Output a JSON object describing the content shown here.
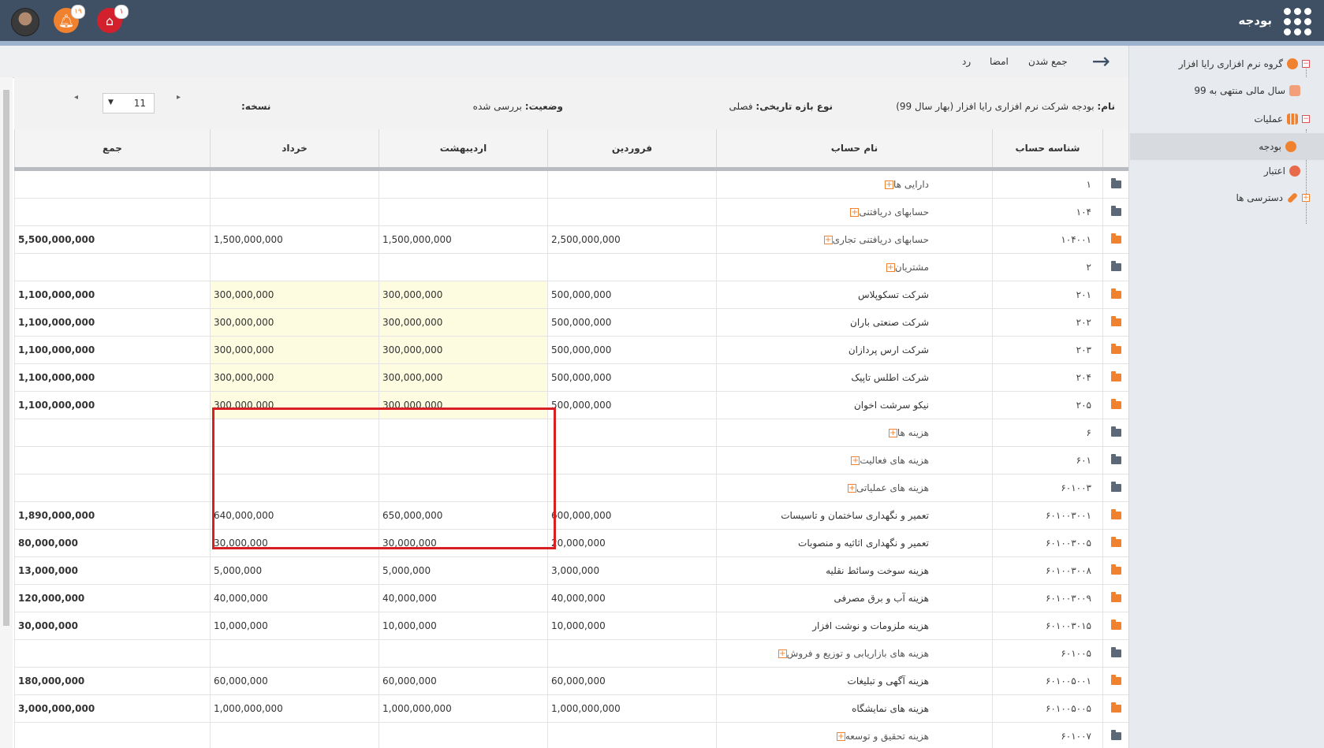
{
  "header": {
    "app_title": "بودجه",
    "notifications": [
      {
        "icon": "bell-icon",
        "count": "۱۹",
        "color": "#f0812e"
      },
      {
        "icon": "alert-icon",
        "count": "۱",
        "color": "#d3202d"
      }
    ]
  },
  "sidebar": {
    "items": [
      {
        "label": "گروه نرم افزاری رایا افزار",
        "icon": "org-icon",
        "toggle": "−"
      },
      {
        "label": "سال مالی منتهی به 99",
        "icon": "calendar-icon"
      },
      {
        "label": "عملیات",
        "icon": "chart-icon",
        "toggle": "−"
      },
      {
        "label": "بودجه",
        "icon": "budget-icon"
      },
      {
        "label": "اعتبار",
        "icon": "credit-icon"
      },
      {
        "label": "دسترسی ها",
        "icon": "wrench-icon",
        "toggle": "+"
      }
    ]
  },
  "toolbar": {
    "collapse": "جمع شدن",
    "sign": "امضا",
    "reject": "رد"
  },
  "info": {
    "name_label": "نام:",
    "name_value": "بودجه شرکت نرم افزاری رایا افزار (بهار سال 99)",
    "period_label": "نوع بازه تاریخی:",
    "period_value": "فصلی",
    "status_label": "وضعیت:",
    "status_value": "بررسی شده",
    "version_label": "نسخه:",
    "version_value": "11"
  },
  "table": {
    "headers": [
      "شناسه حساب",
      "نام حساب",
      "فروردین",
      "اردیبهشت",
      "خرداد",
      "جمع"
    ],
    "rows": [
      {
        "code": "۱",
        "name": "دارایی ها",
        "group": true,
        "folder": "#5b6878",
        "v1": "",
        "v2": "",
        "v3": "",
        "total": ""
      },
      {
        "code": "۱۰۴",
        "name": "حسابهای دریافتنی",
        "group": true,
        "folder": "#5b6878",
        "v1": "",
        "v2": "",
        "v3": "",
        "total": ""
      },
      {
        "code": "۱۰۴۰۰۱",
        "name": "حسابهای دریافتنی تجاری",
        "group": true,
        "folder": "#f0812e",
        "v1": "2,500,000,000",
        "v2": "1,500,000,000",
        "v3": "1,500,000,000",
        "total": "5,500,000,000"
      },
      {
        "code": "۲",
        "name": "مشتریان",
        "group": true,
        "folder": "#5b6878",
        "v1": "",
        "v2": "",
        "v3": "",
        "total": ""
      },
      {
        "code": "۲۰۱",
        "name": "شرکت تسکوپلاس",
        "folder": "#f0812e",
        "hl": true,
        "v1": "500,000,000",
        "v2": "300,000,000",
        "v3": "300,000,000",
        "total": "1,100,000,000"
      },
      {
        "code": "۲۰۲",
        "name": "شرکت صنعتی باران",
        "folder": "#f0812e",
        "hl": true,
        "v1": "500,000,000",
        "v2": "300,000,000",
        "v3": "300,000,000",
        "total": "1,100,000,000"
      },
      {
        "code": "۲۰۳",
        "name": "شرکت ارس پردازان",
        "folder": "#f0812e",
        "hl": true,
        "v1": "500,000,000",
        "v2": "300,000,000",
        "v3": "300,000,000",
        "total": "1,100,000,000"
      },
      {
        "code": "۲۰۴",
        "name": "شرکت اطلس تاپیک",
        "folder": "#f0812e",
        "hl": true,
        "v1": "500,000,000",
        "v2": "300,000,000",
        "v3": "300,000,000",
        "total": "1,100,000,000"
      },
      {
        "code": "۲۰۵",
        "name": "نیکو سرشت اخوان",
        "folder": "#f0812e",
        "hl": true,
        "v1": "500,000,000",
        "v2": "300,000,000",
        "v3": "300,000,000",
        "total": "1,100,000,000"
      },
      {
        "code": "۶",
        "name": "هزینه ها",
        "group": true,
        "folder": "#5b6878",
        "v1": "",
        "v2": "",
        "v3": "",
        "total": ""
      },
      {
        "code": "۶۰۱",
        "name": "هزینه های فعالیت",
        "group": true,
        "folder": "#5b6878",
        "v1": "",
        "v2": "",
        "v3": "",
        "total": ""
      },
      {
        "code": "۶۰۱۰۰۳",
        "name": "هزینه های عملیاتی",
        "group": true,
        "folder": "#5b6878",
        "v1": "",
        "v2": "",
        "v3": "",
        "total": ""
      },
      {
        "code": "۶۰۱۰۰۳۰۰۱",
        "name": "تعمیر و نگهداری ساختمان و تاسیسات",
        "folder": "#f0812e",
        "v1": "600,000,000",
        "v2": "650,000,000",
        "v3": "640,000,000",
        "total": "1,890,000,000"
      },
      {
        "code": "۶۰۱۰۰۳۰۰۵",
        "name": "تعمیر و نگهداری اثاثیه و منصوبات",
        "folder": "#f0812e",
        "v1": "20,000,000",
        "v2": "30,000,000",
        "v3": "30,000,000",
        "total": "80,000,000"
      },
      {
        "code": "۶۰۱۰۰۳۰۰۸",
        "name": "هزینه سوخت وسائط نقلیه",
        "folder": "#f0812e",
        "v1": "3,000,000",
        "v2": "5,000,000",
        "v3": "5,000,000",
        "total": "13,000,000"
      },
      {
        "code": "۶۰۱۰۰۳۰۰۹",
        "name": "هزینه آب و برق مصرفی",
        "folder": "#f0812e",
        "v1": "40,000,000",
        "v2": "40,000,000",
        "v3": "40,000,000",
        "total": "120,000,000"
      },
      {
        "code": "۶۰۱۰۰۳۰۱۵",
        "name": "هزینه ملزومات و نوشت افزار",
        "folder": "#f0812e",
        "v1": "10,000,000",
        "v2": "10,000,000",
        "v3": "10,000,000",
        "total": "30,000,000"
      },
      {
        "code": "۶۰۱۰۰۵",
        "name": "هزینه های بازاریابی و توزیع و فروش",
        "group": true,
        "folder": "#5b6878",
        "v1": "",
        "v2": "",
        "v3": "",
        "total": ""
      },
      {
        "code": "۶۰۱۰۰۵۰۰۱",
        "name": "هزینه آگهی و تبلیغات",
        "folder": "#f0812e",
        "v1": "60,000,000",
        "v2": "60,000,000",
        "v3": "60,000,000",
        "total": "180,000,000"
      },
      {
        "code": "۶۰۱۰۰۵۰۰۵",
        "name": "هزینه های نمایشگاه",
        "folder": "#f0812e",
        "v1": "1,000,000,000",
        "v2": "1,000,000,000",
        "v3": "1,000,000,000",
        "total": "3,000,000,000"
      },
      {
        "code": "۶۰۱۰۰۷",
        "name": "هزینه تحقیق و توسعه",
        "group": true,
        "folder": "#5b6878",
        "v1": "",
        "v2": "",
        "v3": "",
        "total": ""
      }
    ]
  }
}
